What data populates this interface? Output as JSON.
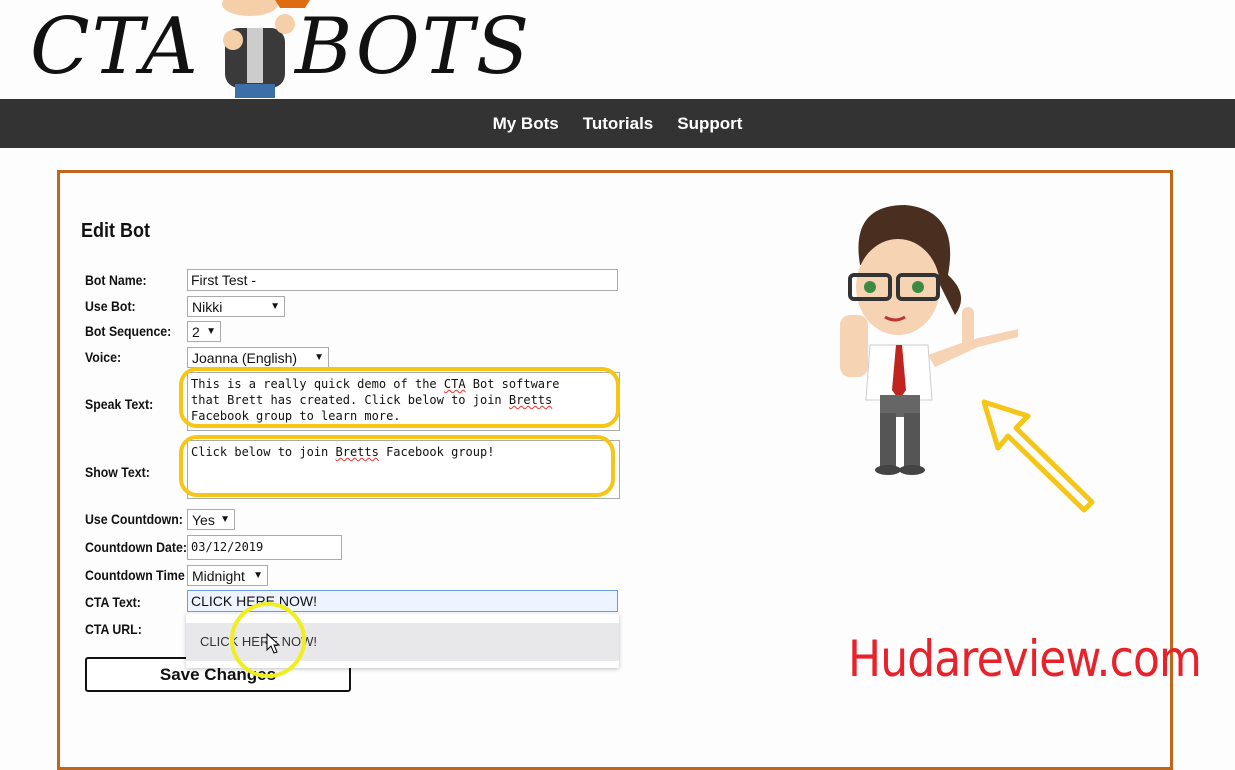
{
  "logo": {
    "text_left": "CTA",
    "text_right": "BOTS"
  },
  "nav": [
    "My Bots",
    "Tutorials",
    "Support"
  ],
  "form": {
    "title": "Edit Bot",
    "bot_name": {
      "label": "Bot Name:",
      "value": "First Test -"
    },
    "use_bot": {
      "label": "Use Bot:",
      "value": "Nikki"
    },
    "bot_sequence": {
      "label": "Bot Sequence:",
      "value": "2"
    },
    "voice": {
      "label": "Voice:",
      "value": "Joanna (English)"
    },
    "speak_text": {
      "label": "Speak Text:",
      "line1a": "This is a really quick demo of the ",
      "line1b": "CTA",
      "line1c": " Bot software",
      "line2a": "that Brett has created. Click below to join ",
      "line2b": "Bretts",
      "line3": "Facebook group to learn more."
    },
    "show_text": {
      "label": "Show Text:",
      "a": "Click below to join ",
      "b": "Bretts",
      "c": " Facebook group!"
    },
    "use_countdown": {
      "label": "Use Countdown:",
      "value": "Yes"
    },
    "countdown_date": {
      "label": "Countdown Date:",
      "value": "03/12/2019"
    },
    "countdown_time": {
      "label": "Countdown Time",
      "value": "Midnight"
    },
    "cta_text": {
      "label": "CTA Text:",
      "value": "CLICK HERE NOW!"
    },
    "cta_url": {
      "label": "CTA URL:"
    },
    "autocomplete": "CLICK HERE NOW!",
    "save": "Save Changes"
  },
  "watermark": "Hudareview.com",
  "colors": {
    "nav_bg": "#333333",
    "box_border": "#c0661a",
    "highlight": "#f5c518",
    "watermark": "#e8222a"
  }
}
